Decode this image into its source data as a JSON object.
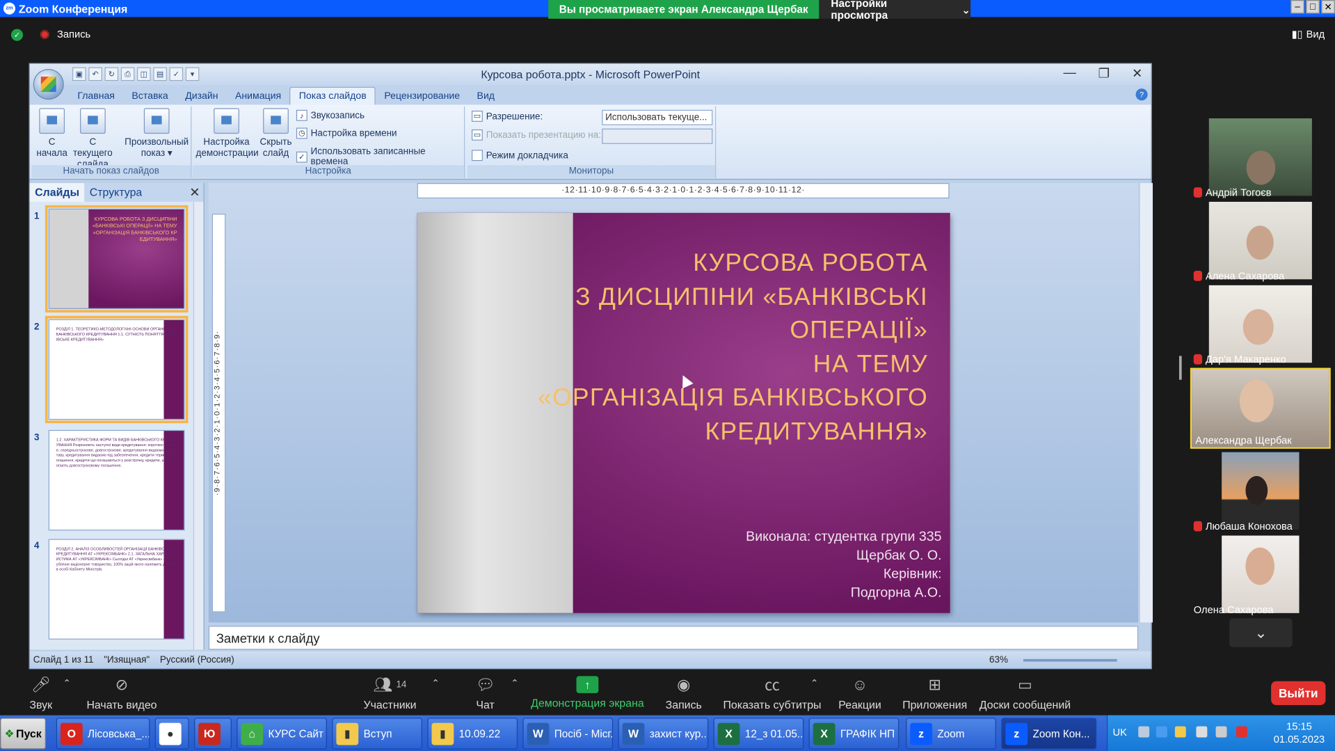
{
  "zoom": {
    "app_title": "Zoom Конференция",
    "share_banner": "Вы просматриваете экран Александра Щербак",
    "view_options": "Настройки просмотра",
    "recording_label": "Запись",
    "view_button": "Вид",
    "leave_button": "Выйти",
    "toolbar": {
      "audio": "Звук",
      "video": "Начать видео",
      "participants": "Участники",
      "participants_count": "14",
      "chat": "Чат",
      "share": "Демонстрация экрана",
      "record": "Запись",
      "captions": "Показать субтитры",
      "reactions": "Реакции",
      "apps": "Приложения",
      "whiteboards": "Доски сообщений"
    },
    "participants": [
      {
        "name": "Андрій Тогоєв",
        "muted": true
      },
      {
        "name": "Алена Сахарова",
        "muted": true
      },
      {
        "name": "Дар'я Макаренко",
        "muted": true
      },
      {
        "name": "Александра Щербак",
        "muted": false
      },
      {
        "name": "Любаша Конохова",
        "muted": true
      },
      {
        "name": "Олена Сахарова",
        "muted": false
      }
    ]
  },
  "ppt": {
    "caption": "Курсова робота.pptx - Microsoft PowerPoint",
    "tabs": [
      "Главная",
      "Вставка",
      "Дизайн",
      "Анимация",
      "Показ слайдов",
      "Рецензирование",
      "Вид"
    ],
    "active_tab": "Показ слайдов",
    "ribbon": {
      "from_start": "С начала",
      "from_current": "С текущего слайда",
      "custom_show": "Произвольный показ",
      "group1": "Начать показ слайдов",
      "setup_show": "Настройка демонстрации",
      "hide_slide": "Скрыть слайд",
      "record_narration": "Звукозапись",
      "rehearse": "Настройка времени",
      "use_timings": "Использовать записанные времена",
      "group2": "Настройка",
      "resolution_label": "Разрешение:",
      "resolution_value": "Использовать текуще...",
      "show_on_label": "Показать презентацию на:",
      "presenter_view": "Режим докладчика",
      "group3": "Мониторы"
    },
    "pane_tabs": [
      "Слайды",
      "Структура"
    ],
    "thumbs": [
      {
        "num": "1",
        "text": "КУРСОВА РОБОТА З ДИСЦИПІНИ «БАНКІВСЬКІ ОПЕРАЦІЇ» НА ТЕМУ «ОРГАНІЗАЦІЯ БАНКІВСЬКОГО КРЕДИТУВАННЯ»"
      },
      {
        "num": "2",
        "text": "РОЗДІЛ 1. ТЕОРЕТИКО-МЕТОДОЛОГІЧНІ ОСНОВИ ОРГАНІЗАЦІЇ БАНКІВСЬКОГО КРЕДИТУВАННЯ 1.1. СУТНІСТЬ ПОНЯТТЯ «БАНКІВСЬКЕ КРЕДИТУВАННЯ»"
      },
      {
        "num": "3",
        "text": "1.2. ХАРАКТЕРИСТИКА ФОРМ ТА ВИДІВ БАНКІВСЬКОГО КРЕДИТУВАННЯ Розрізняють наступні види кредитування: короткострокове, середньострокове, довгострокове, кредитування видаємо під заставу, кредитування видаємо під забезпечення, кредити терміново погашення, кредити що погашаються у розстрочку, кредити, що підлягають довгостроковому погашенню."
      },
      {
        "num": "4",
        "text": "РОЗДІЛ 2. АНАЛІЗ ОСОБЛИВОСТЕЙ ОРГАНІЗАЦІЇ БАНКІВСЬКОГО КРЕДИТУВАННЯ АТ «УКРЕКСІМБАНК» 2.1. ЗАГАЛЬНА ХАРАКТЕРИСТИКА АТ «УКРЕКСІМБАНК» Сьогодні АТ «Укрексімбанк» — це публічне акціонерне товариство, 100% акцій якого належить державі в особі Кабінету Міністрів."
      }
    ],
    "slide": {
      "title_lines": [
        "КУРСОВА РОБОТА",
        "З ДИСЦИПІНИ «БАНКІВСЬКІ",
        "ОПЕРАЦІЇ»",
        "НА ТЕМУ",
        "«ОРГАНІЗАЦІЯ БАНКІВСЬКОГО",
        "КРЕДИТУВАННЯ»"
      ],
      "info_lines": [
        "Виконала: студентка групи 335",
        "Щербак О. О.",
        "Керівник:",
        "Подгорна  А.О."
      ]
    },
    "notes_placeholder": "Заметки к слайду",
    "status": {
      "slide_count": "Слайд 1 из 11",
      "theme": "\"Изящная\"",
      "language": "Русский (Россия)",
      "zoom": "63%"
    },
    "ruler_h": "·12·11·10·9·8·7·6·5·4·3·2·1·0·1·2·3·4·5·6·7·8·9·10·11·12·",
    "ruler_v": "·9·8·7·6·5·4·3·2·1·0·1·2·3·4·5·6·7·8·9·"
  },
  "taskbar": {
    "start": "Пуск",
    "items": [
      {
        "label": "Лісовська_...",
        "color": "#d9231d",
        "glyph": "O"
      },
      {
        "label": "",
        "color": "#ffffff",
        "glyph": "●"
      },
      {
        "label": "",
        "color": "#c8281e",
        "glyph": "Ю"
      },
      {
        "label": "КУРС Сайт ...",
        "color": "#3fae49",
        "glyph": "⌂"
      },
      {
        "label": "Вступ",
        "color": "#f2c94c",
        "glyph": "▮"
      },
      {
        "label": "10.09.22",
        "color": "#f2c94c",
        "glyph": "▮"
      },
      {
        "label": "Посіб - Місг...",
        "color": "#2b5fb4",
        "glyph": "W"
      },
      {
        "label": "захист кур...",
        "color": "#2b5fb4",
        "glyph": "W"
      },
      {
        "label": "12_з 01.05...",
        "color": "#1d6f42",
        "glyph": "X"
      },
      {
        "label": "ГРАФІК НП ...",
        "color": "#1d6f42",
        "glyph": "X"
      },
      {
        "label": "Zoom",
        "color": "#0b5cff",
        "glyph": "z"
      },
      {
        "label": "Zoom Кон...",
        "color": "#0b5cff",
        "glyph": "z"
      }
    ],
    "lang": "UK",
    "time": "15:15",
    "date": "01.05.2023"
  }
}
